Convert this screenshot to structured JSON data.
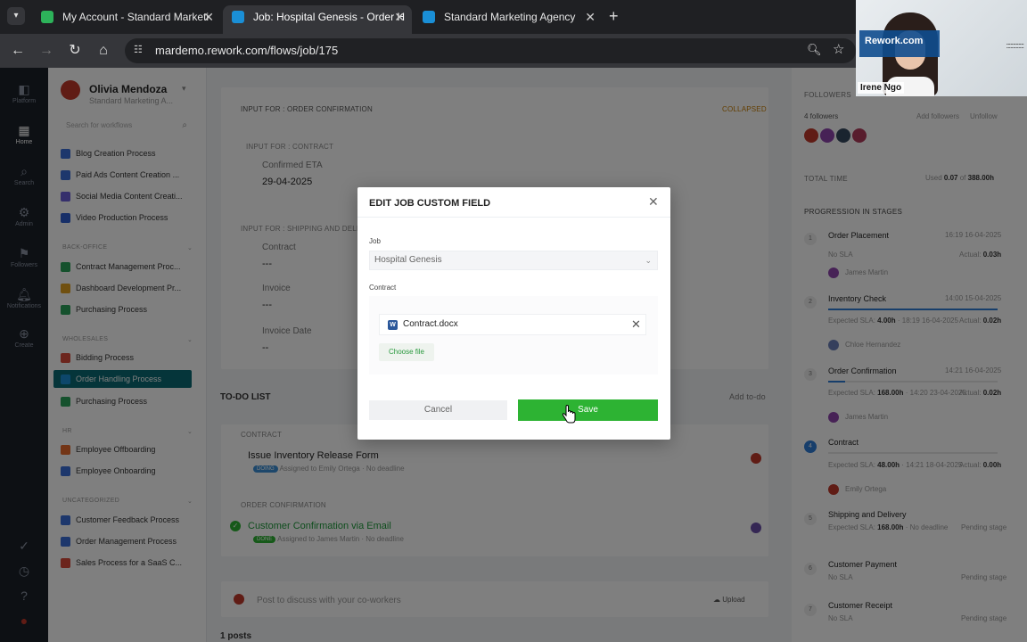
{
  "browser": {
    "tabs": [
      {
        "title": "My Account - Standard Marketi",
        "favicon_color": "#2db35a",
        "active": false
      },
      {
        "title": "Job: Hospital Genesis - Order H",
        "favicon_color": "#1a8fd6",
        "active": true
      },
      {
        "title": "Standard Marketing Agency",
        "favicon_color": "#1a8fd6",
        "active": false
      }
    ],
    "url": "mardemo.rework.com/flows/job/175"
  },
  "video_overlay": {
    "brand": "Rework.com",
    "name": "Irene Ngo"
  },
  "rail": [
    {
      "icon": "platform-icon",
      "label": "Platform"
    },
    {
      "icon": "home-icon",
      "label": "Home"
    },
    {
      "icon": "search-icon",
      "label": "Search"
    },
    {
      "icon": "admin-icon",
      "label": "Admin"
    },
    {
      "icon": "followers-icon",
      "label": "Followers"
    },
    {
      "icon": "notification-icon",
      "label": "Notifications"
    },
    {
      "icon": "create-icon",
      "label": "Create"
    }
  ],
  "sidebar": {
    "user_name": "Olivia Mendoza",
    "user_org": "Standard Marketing A...",
    "search_placeholder": "Search for workflows",
    "items_top": [
      {
        "label": "Blog Creation Process",
        "color": "#3b6fd8"
      },
      {
        "label": "Paid Ads Content Creation ...",
        "color": "#3b6fd8"
      },
      {
        "label": "Social Media Content Creati...",
        "color": "#6b5fd8"
      },
      {
        "label": "Video Production Process",
        "color": "#2e5fd0"
      }
    ],
    "section_backoffice": "BACK-OFFICE",
    "items_backoffice": [
      {
        "label": "Contract Management Proc...",
        "color": "#2aa35a"
      },
      {
        "label": "Dashboard Development Pr...",
        "color": "#e0a020"
      },
      {
        "label": "Purchasing Process",
        "color": "#2aa35a"
      }
    ],
    "section_wholesales": "WHOLESALES",
    "items_wholesales": [
      {
        "label": "Bidding Process",
        "color": "#d84a3b"
      },
      {
        "label": "Order Handling Process",
        "color": "#1a8fd6"
      },
      {
        "label": "Purchasing Process",
        "color": "#2aa35a"
      }
    ],
    "section_hr": "HR",
    "items_hr": [
      {
        "label": "Employee Offboarding",
        "color": "#e66a2c"
      },
      {
        "label": "Employee Onboarding",
        "color": "#3b6fd8"
      }
    ],
    "section_uncategorized": "UNCATEGORIZED",
    "items_uncategorized": [
      {
        "label": "Customer Feedback Process",
        "color": "#3b6fd8"
      },
      {
        "label": "Order Management Process",
        "color": "#3b6fd8"
      },
      {
        "label": "Sales Process for a SaaS C...",
        "color": "#d84a3b"
      }
    ]
  },
  "main": {
    "input_order_confirmation": "INPUT FOR : ORDER CONFIRMATION",
    "collapsed": "COLLAPSED",
    "input_contract": "INPUT FOR : CONTRACT",
    "confirmed_eta_label": "Confirmed ETA",
    "confirmed_eta_value": "29-04-2025",
    "input_shipping": "INPUT FOR : SHIPPING AND DELI",
    "contract_label": "Contract",
    "contract_value": "---",
    "invoice_label": "Invoice",
    "invoice_value": "---",
    "invoice_date_label": "Invoice Date",
    "invoice_date_value": "--",
    "todo_title": "TO-DO LIST",
    "add_todo": "Add to-do",
    "todo_section_contract": "CONTRACT",
    "task1_title": "Issue Inventory Release Form",
    "task1_badge": "DOING",
    "task1_meta": "Assigned to Emily Ortega · No deadline",
    "todo_section_order": "ORDER CONFIRMATION",
    "task2_title": "Customer Confirmation via Email",
    "task2_badge": "DONE",
    "task2_meta": "Assigned to James Martin · No deadline",
    "post_placeholder": "Post to discuss with your co-workers",
    "upload": "Upload",
    "posts_count": "1 posts"
  },
  "right": {
    "followers_title": "FOLLOWERS",
    "followers_count": "4 followers",
    "add_followers": "Add followers",
    "unfollow": "Unfollow",
    "total_time_title": "TOTAL TIME",
    "total_time_prefix": "Used",
    "total_time_used": "0.07",
    "total_time_of": "of",
    "total_time_total": "388.00h",
    "progression_title": "PROGRESSION IN STAGES",
    "stages": [
      {
        "num": "1",
        "name": "Order Placement",
        "date": "16:19 16-04-2025",
        "sla": "No SLA",
        "actual_label": "Actual:",
        "actual": "0.03h",
        "assignee": "James Martin",
        "progress": 1.0
      },
      {
        "num": "2",
        "name": "Inventory Check",
        "date": "14:00 15-04-2025",
        "sla_label": "Expected SLA:",
        "sla_value": "4.00h",
        "sla_date": "· 18:19 16-04-2025",
        "actual_label": "Actual:",
        "actual": "0.02h",
        "assignee": "Chloe Hernandez",
        "progress": 1.0
      },
      {
        "num": "3",
        "name": "Order Confirmation",
        "date": "14:21 16-04-2025",
        "sla_label": "Expected SLA:",
        "sla_value": "168.00h",
        "sla_date": "· 14:20 23-04-2025",
        "actual_label": "Actual:",
        "actual": "0.02h",
        "assignee": "James Martin",
        "progress": 0.1
      },
      {
        "num": "4",
        "name": "Contract",
        "sla_label": "Expected SLA:",
        "sla_value": "48.00h",
        "sla_date": "· 14:21 18-04-2025",
        "actual_label": "Actual:",
        "actual": "0.00h",
        "assignee": "Emily Ortega",
        "progress": 0.0
      },
      {
        "num": "5",
        "name": "Shipping and Delivery",
        "sla_label": "Expected SLA:",
        "sla_value": "168.00h",
        "sla_date": "· No deadline",
        "pending": "Pending stage"
      },
      {
        "num": "6",
        "name": "Customer Payment",
        "sla": "No SLA",
        "pending": "Pending stage"
      },
      {
        "num": "7",
        "name": "Customer Receipt",
        "sla": "No SLA",
        "pending": "Pending stage"
      }
    ]
  },
  "modal": {
    "title": "EDIT JOB CUSTOM FIELD",
    "job_label": "Job",
    "job_value": "Hospital Genesis",
    "contract_label": "Contract",
    "file_name": "Contract.docx",
    "choose_file": "Choose file",
    "cancel": "Cancel",
    "save": "Save"
  },
  "colors": {
    "accent_green": "#2db333",
    "sidebar_active": "#0b6b74",
    "rail_bg": "#1b2029"
  }
}
